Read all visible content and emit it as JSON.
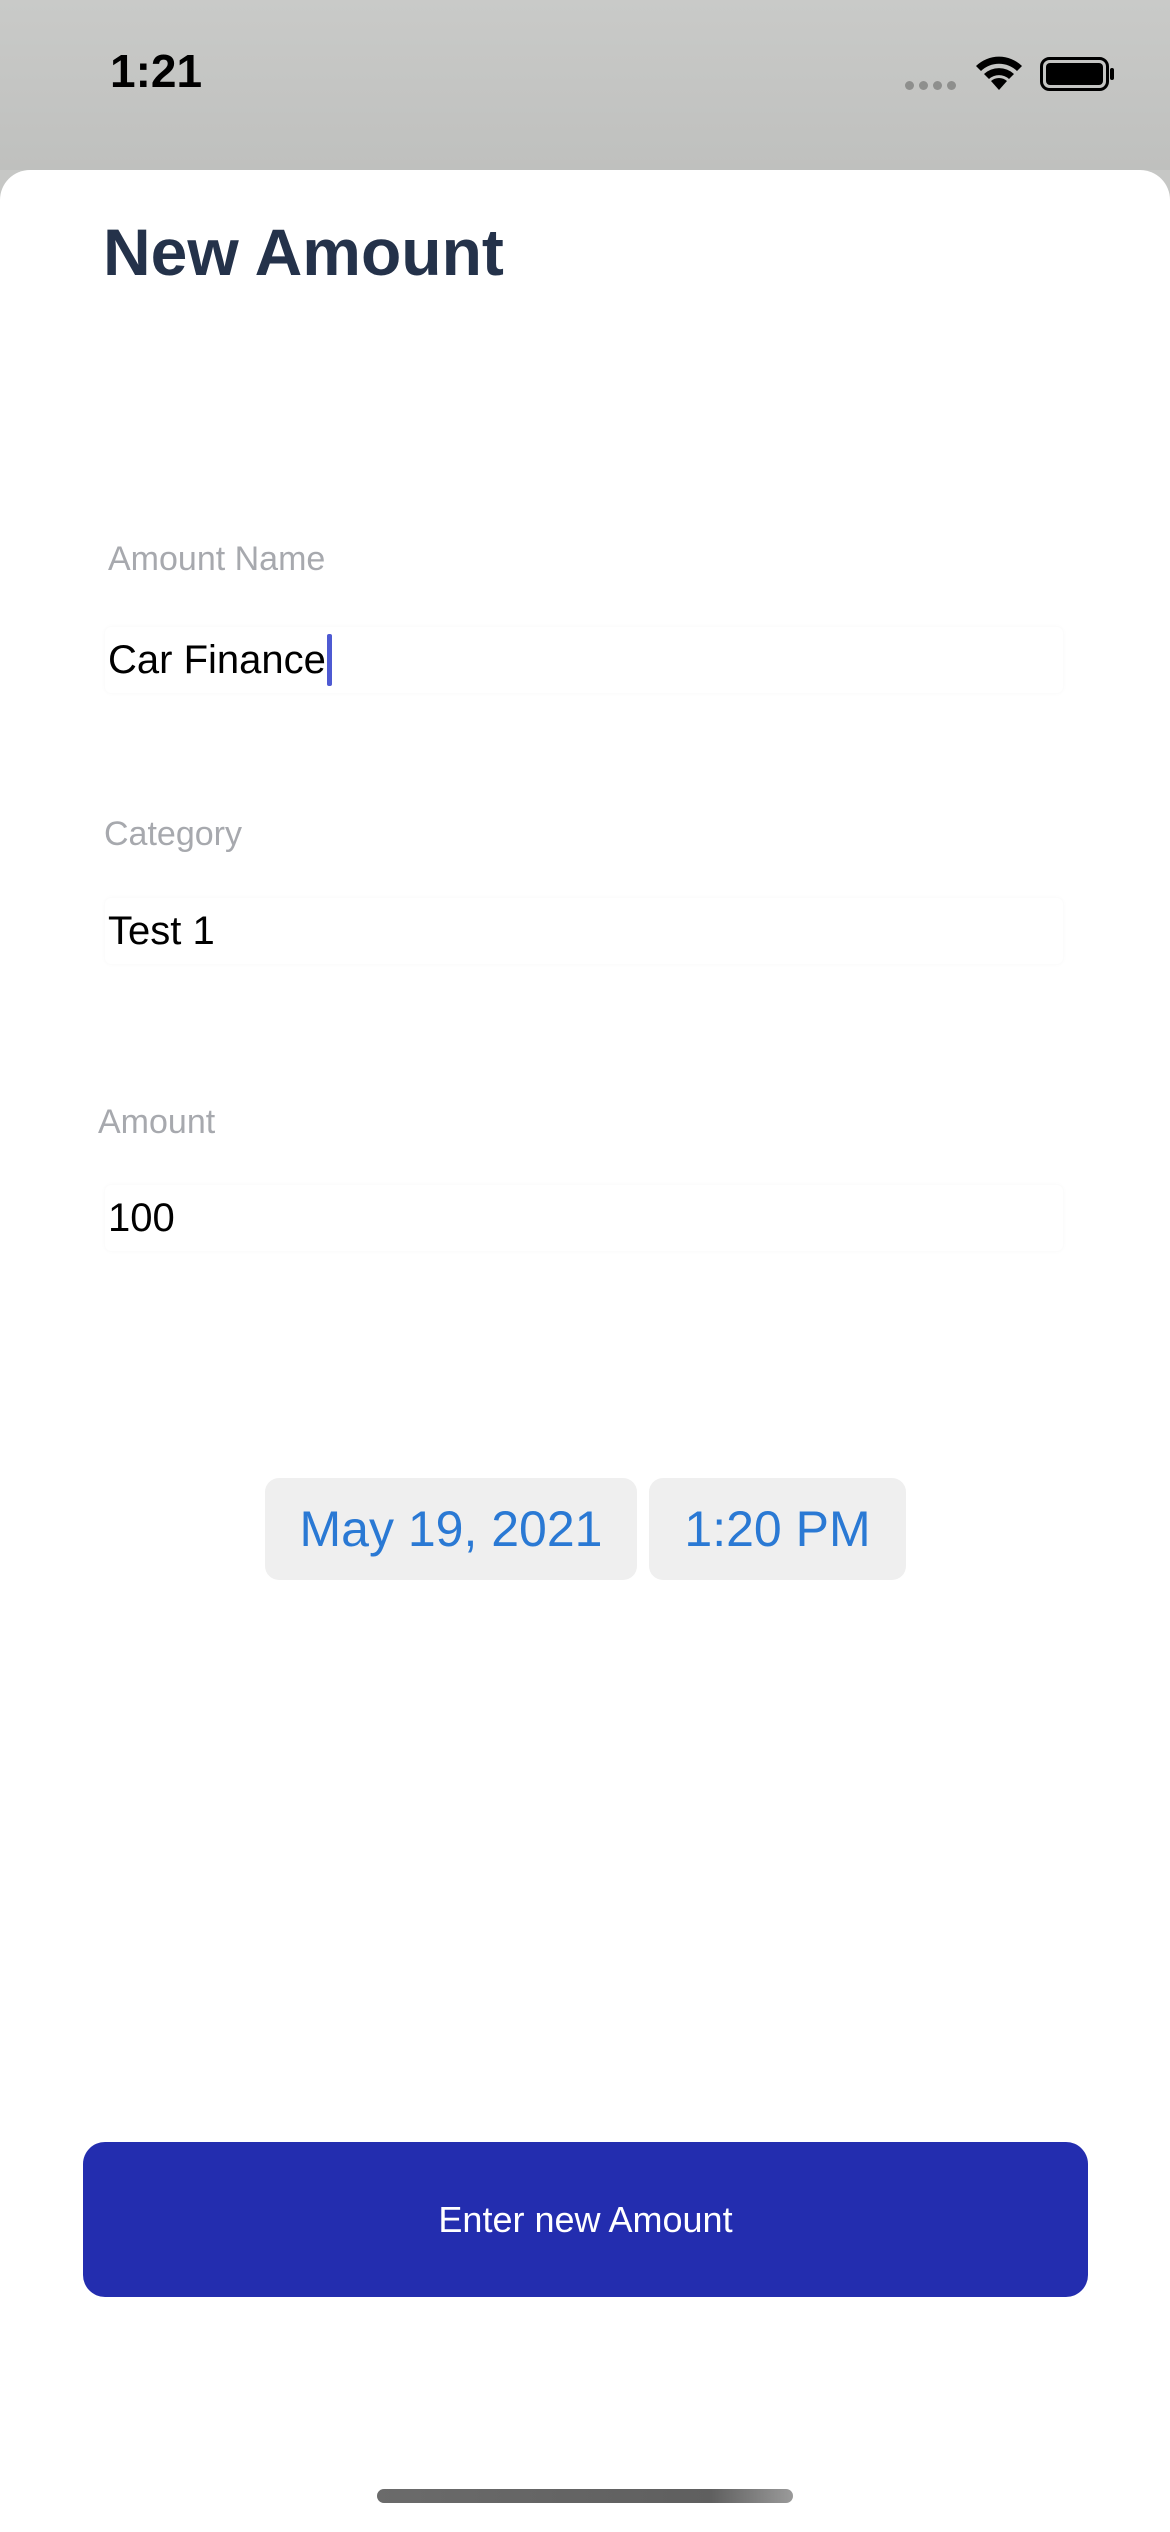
{
  "status_bar": {
    "time": "1:21"
  },
  "form": {
    "title": "New Amount",
    "amount_name": {
      "label": "Amount Name",
      "value": "Car Finance"
    },
    "category": {
      "label": "Category",
      "value": "Test 1"
    },
    "amount": {
      "label": "Amount",
      "value": "100"
    },
    "date": "May 19, 2021",
    "time": "1:20 PM",
    "submit_label": "Enter new Amount"
  },
  "colors": {
    "title": "#24324a",
    "accent_button": "#232daf",
    "picker_text": "#2a79d4",
    "picker_bg": "#efefef",
    "label": "#a7a9ae"
  },
  "icons": [
    "cellular-signal-icon",
    "wifi-icon",
    "battery-icon"
  ]
}
